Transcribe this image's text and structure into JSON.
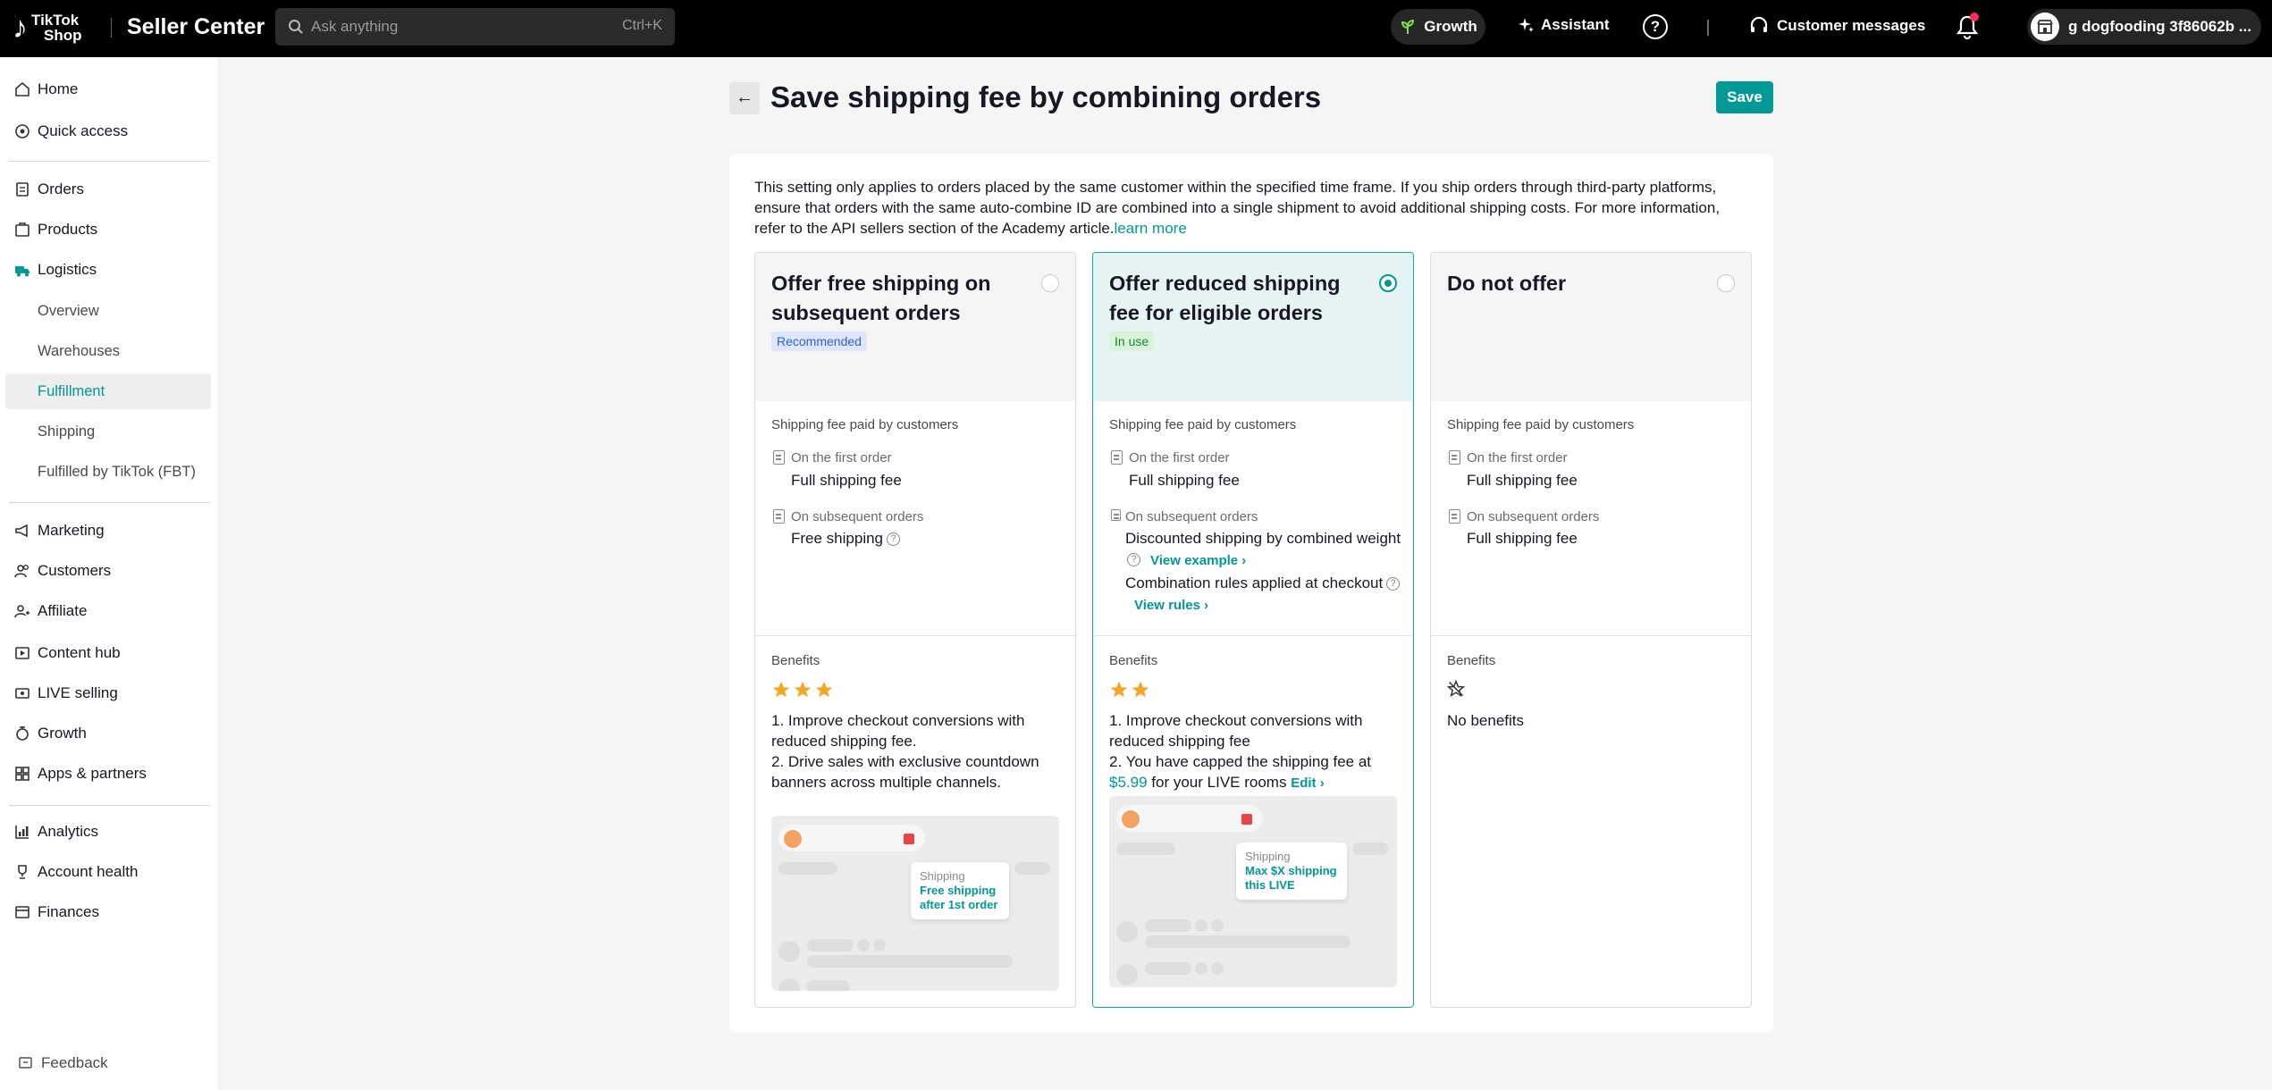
{
  "topbar": {
    "logo_text_1": "TikTok",
    "logo_text_2": "Shop",
    "app_title": "Seller Center",
    "search_placeholder": "Ask anything",
    "search_shortcut": "Ctrl+K",
    "growth_label": "Growth",
    "assistant_label": "Assistant",
    "help_label": "?",
    "customer_messages_label": "Customer messages",
    "account_name": "g dogfooding 3f86062b ..."
  },
  "sidebar": {
    "home": "Home",
    "quick_access": "Quick access",
    "orders": "Orders",
    "products": "Products",
    "logistics": "Logistics",
    "overview": "Overview",
    "warehouses": "Warehouses",
    "fulfillment": "Fulfillment",
    "shipping": "Shipping",
    "fbt": "Fulfilled by TikTok (FBT)",
    "marketing": "Marketing",
    "customers": "Customers",
    "affiliate": "Affiliate",
    "content_hub": "Content hub",
    "live_selling": "LIVE selling",
    "growth": "Growth",
    "apps_partners": "Apps & partners",
    "analytics": "Analytics",
    "account_health": "Account health",
    "finances": "Finances",
    "feedback": "Feedback"
  },
  "page": {
    "title": "Save shipping fee by combining orders",
    "save_label": "Save",
    "description": "This setting only applies to orders placed by the same customer within the specified time frame. If you ship orders through third-party platforms, ensure that orders with the same auto-combine ID are combined into a single shipment to avoid additional shipping costs. For more information, refer to the API sellers section of the Academy article.",
    "learn_more": "learn more"
  },
  "options": [
    {
      "title": "Offer free shipping on subsequent orders",
      "badge": "Recommended",
      "selected": false,
      "fee_heading": "Shipping fee paid by customers",
      "first_label": "On the first order",
      "first_value": "Full shipping fee",
      "subsequent_label": "On subsequent orders",
      "subsequent_value": "Free shipping",
      "benefits_heading": "Benefits",
      "stars": 3,
      "benefit_1": "1. Improve checkout conversions with reduced shipping fee.",
      "benefit_2": "2. Drive sales with exclusive countdown banners across multiple channels.",
      "popup_label": "Shipping",
      "popup_value": "Free shipping after 1st order"
    },
    {
      "title": "Offer reduced shipping fee for eligible orders",
      "badge": "In use",
      "selected": true,
      "fee_heading": "Shipping fee paid by customers",
      "first_label": "On the first order",
      "first_value": "Full shipping fee",
      "subsequent_label": "On subsequent orders",
      "subsequent_value": "Discounted shipping by combined weight",
      "view_example": "View example",
      "combination_rules": "Combination rules applied at checkout",
      "view_rules": "View rules",
      "benefits_heading": "Benefits",
      "stars": 2,
      "benefit_1": "1. Improve checkout conversions with reduced shipping fee",
      "benefit_2_prefix": "2. You have capped the shipping fee at",
      "benefit_2_price": "$5.99",
      "benefit_2_suffix": "for your LIVE rooms",
      "edit_label": "Edit",
      "popup_label": "Shipping",
      "popup_value": "Max $X shipping this LIVE"
    },
    {
      "title": "Do not offer",
      "selected": false,
      "fee_heading": "Shipping fee paid by customers",
      "first_label": "On the first order",
      "first_value": "Full shipping fee",
      "subsequent_label": "On subsequent orders",
      "subsequent_value": "Full shipping fee",
      "benefits_heading": "Benefits",
      "stars": 0,
      "no_benefits": "No benefits"
    }
  ],
  "colors": {
    "accent": "#009995",
    "selected_card_bg": "#e6f5f4",
    "star": "#f5a623",
    "recommended_badge": "#dfe6ff",
    "in_use_badge": "#d8f2dc"
  }
}
